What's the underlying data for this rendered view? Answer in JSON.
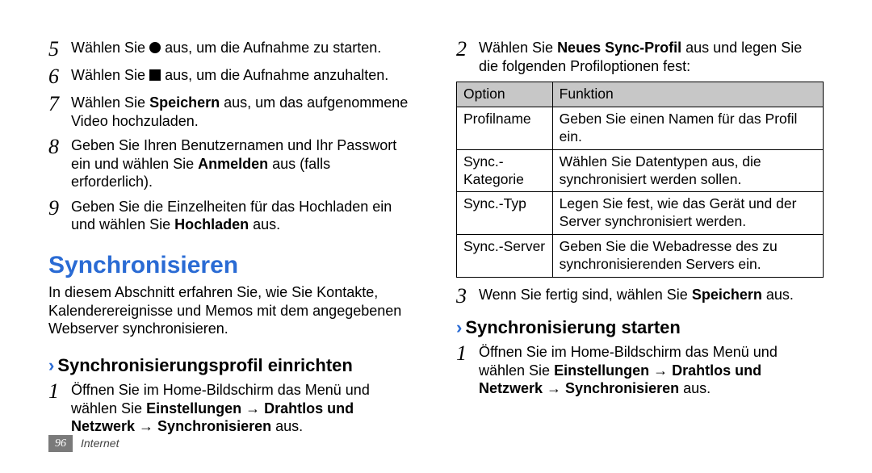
{
  "left": {
    "steps": [
      {
        "num": "5",
        "pre": "Wählen Sie ",
        "icon": "circle",
        "post": " aus, um die Aufnahme zu starten."
      },
      {
        "num": "6",
        "pre": "Wählen Sie ",
        "icon": "square",
        "post": " aus, um die Aufnahme anzuhalten."
      },
      {
        "num": "7",
        "pre": "Wählen Sie ",
        "bold1": "Speichern",
        "post": " aus, um das aufgenommene Video hochzuladen."
      },
      {
        "num": "8",
        "pre": "Geben Sie Ihren Benutzernamen und Ihr Passwort ein und wählen Sie ",
        "bold1": "Anmelden",
        "post": " aus (falls erforderlich)."
      },
      {
        "num": "9",
        "pre": "Geben Sie die Einzelheiten für das Hochladen ein und wählen Sie ",
        "bold1": "Hochladen",
        "post": " aus."
      }
    ],
    "sync_title": "Synchronisieren",
    "intro": "In diesem Abschnitt erfahren Sie, wie Sie Kontakte, Kalenderereignisse und Memos mit dem angegebenen Webserver synchronisieren.",
    "sub1": "Synchronisierungsprofil einrichten",
    "sub1_step1_num": "1",
    "sub1_step1_a": "Öffnen Sie im Home-Bildschirm das Menü und wählen Sie ",
    "sub1_step1_b1": "Einstellungen",
    "sub1_step1_arrow": " → ",
    "sub1_step1_b2": "Drahtlos und Netzwerk",
    "sub1_step1_b3": "Synchronisieren",
    "sub1_step1_end": " aus."
  },
  "right": {
    "step2_num": "2",
    "step2_a": "Wählen Sie ",
    "step2_b": "Neues Sync-Profil",
    "step2_c": " aus und legen Sie die folgenden Profiloptionen fest:",
    "table": {
      "head_option": "Option",
      "head_funktion": "Funktion",
      "rows": [
        {
          "opt": "Profilname",
          "fn": "Geben Sie einen Namen für das Profil ein."
        },
        {
          "opt": "Sync.-Kategorie",
          "fn": "Wählen Sie Datentypen aus, die synchronisiert werden sollen."
        },
        {
          "opt": "Sync.-Typ",
          "fn": "Legen Sie fest, wie das Gerät und der Server synchronisiert werden."
        },
        {
          "opt": "Sync.-Server",
          "fn": "Geben Sie die Webadresse des zu synchronisierenden Servers ein."
        }
      ]
    },
    "step3_num": "3",
    "step3_a": "Wenn Sie fertig sind, wählen Sie ",
    "step3_b": "Speichern",
    "step3_c": " aus.",
    "sub2": "Synchronisierung starten",
    "sub2_step1_num": "1",
    "sub2_step1_a": "Öffnen Sie im Home-Bildschirm das Menü und wählen Sie ",
    "sub2_step1_b1": "Einstellungen",
    "sub2_step1_arrow": " → ",
    "sub2_step1_b2": "Drahtlos und Netzwerk",
    "sub2_step1_b3": "Synchronisieren",
    "sub2_step1_end": " aus."
  },
  "footer": {
    "page": "96",
    "section": "Internet"
  }
}
